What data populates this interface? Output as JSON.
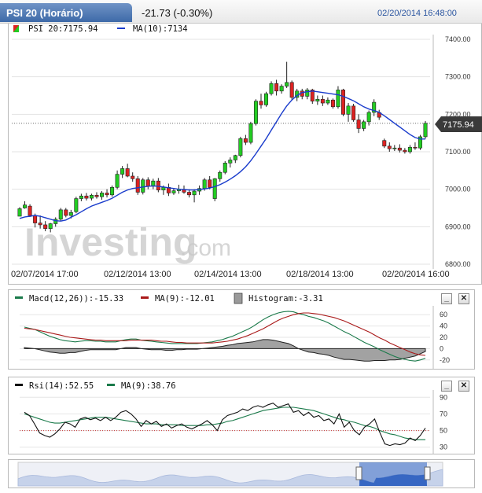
{
  "header": {
    "title": "PSI 20 (Horário)",
    "change": "-21.73 (-0.30%)",
    "datetime": "02/20/2014 16:48:00"
  },
  "main_legend": {
    "price": "PSI 20:7175.94",
    "ma": "MA(10):7134"
  },
  "last_price_label": "7175.94",
  "watermark": {
    "brand": "Investing",
    "suffix": ".com"
  },
  "colors": {
    "up": "#22cc22",
    "down": "#dd2222",
    "ma": "#1a3ccc",
    "macd": "#1a7a4a",
    "signal": "#aa1a1a",
    "hist": "#8a8a8a",
    "rsi": "#111111",
    "rsi_ma": "#1a7a4a"
  },
  "macd_legend": {
    "macd": "Macd(12,26)):-15.33",
    "ma": "MA(9):-12.01",
    "hist": "Histogram:-3.31"
  },
  "rsi_legend": {
    "rsi": "Rsi(14):52.55",
    "ma": "MA(9):38.76"
  },
  "chart_data": [
    {
      "type": "candlestick",
      "title": "PSI 20 (Horário)",
      "ylim": [
        6800,
        7400
      ],
      "y_ticks": [
        "7400.00",
        "7300.00",
        "7200.00",
        "7100.00",
        "7000.00",
        "6900.00",
        "6800.00"
      ],
      "x_tick_labels": [
        "02/07/2014 17:00",
        "02/12/2014 13:00",
        "02/14/2014 13:00",
        "02/18/2014 13:00",
        "02/20/2014 16:00"
      ],
      "x_tick_index": [
        0,
        20,
        40,
        60,
        80
      ],
      "candles": [
        [
          6928,
          6952,
          6928,
          6948
        ],
        [
          6950,
          6968,
          6948,
          6958
        ],
        [
          6955,
          6960,
          6926,
          6930
        ],
        [
          6930,
          6935,
          6898,
          6910
        ],
        [
          6910,
          6930,
          6895,
          6905
        ],
        [
          6905,
          6915,
          6888,
          6895
        ],
        [
          6895,
          6910,
          6885,
          6908
        ],
        [
          6908,
          6925,
          6900,
          6920
        ],
        [
          6920,
          6950,
          6915,
          6945
        ],
        [
          6945,
          6950,
          6925,
          6930
        ],
        [
          6930,
          6945,
          6922,
          6938
        ],
        [
          6940,
          6980,
          6936,
          6975
        ],
        [
          6975,
          6988,
          6968,
          6982
        ],
        [
          6982,
          6990,
          6970,
          6976
        ],
        [
          6976,
          6988,
          6970,
          6984
        ],
        [
          6984,
          6992,
          6975,
          6980
        ],
        [
          6980,
          6995,
          6972,
          6990
        ],
        [
          6990,
          7000,
          6978,
          6985
        ],
        [
          6985,
          7010,
          6980,
          7005
        ],
        [
          7005,
          7050,
          7000,
          7040
        ],
        [
          7040,
          7062,
          7030,
          7055
        ],
        [
          7055,
          7068,
          7032,
          7035
        ],
        [
          7035,
          7045,
          7020,
          7028
        ],
        [
          7028,
          7035,
          6985,
          6992
        ],
        [
          6992,
          7030,
          6986,
          7025
        ],
        [
          7025,
          7032,
          7000,
          7008
        ],
        [
          7008,
          7028,
          7000,
          7022
        ],
        [
          7022,
          7030,
          6992,
          6998
        ],
        [
          6998,
          7010,
          6985,
          7005
        ],
        [
          7005,
          7015,
          6982,
          6990
        ],
        [
          6990,
          7002,
          6985,
          6996
        ],
        [
          6996,
          7012,
          6988,
          7000
        ],
        [
          7000,
          7010,
          6988,
          6992
        ],
        [
          6992,
          7000,
          6978,
          6985
        ],
        [
          6985,
          7000,
          6965,
          6995
        ],
        [
          6995,
          7010,
          6985,
          7002
        ],
        [
          7002,
          7030,
          6996,
          7025
        ],
        [
          7025,
          7035,
          7000,
          7005
        ],
        [
          6975,
          7030,
          6968,
          7028
        ],
        [
          7028,
          7050,
          7020,
          7045
        ],
        [
          7045,
          7075,
          7040,
          7070
        ],
        [
          7070,
          7085,
          7058,
          7078
        ],
        [
          7078,
          7092,
          7070,
          7090
        ],
        [
          7090,
          7140,
          7085,
          7135
        ],
        [
          7135,
          7145,
          7118,
          7125
        ],
        [
          7125,
          7180,
          7120,
          7175
        ],
        [
          7175,
          7240,
          7170,
          7235
        ],
        [
          7235,
          7255,
          7215,
          7225
        ],
        [
          7225,
          7260,
          7220,
          7255
        ],
        [
          7255,
          7288,
          7250,
          7282
        ],
        [
          7282,
          7292,
          7250,
          7262
        ],
        [
          7262,
          7280,
          7255,
          7275
        ],
        [
          7275,
          7340,
          7270,
          7285
        ],
        [
          7285,
          7290,
          7238,
          7245
        ],
        [
          7245,
          7268,
          7235,
          7262
        ],
        [
          7262,
          7268,
          7240,
          7248
        ],
        [
          7248,
          7270,
          7240,
          7265
        ],
        [
          7265,
          7268,
          7228,
          7235
        ],
        [
          7235,
          7250,
          7225,
          7240
        ],
        [
          7240,
          7250,
          7222,
          7230
        ],
        [
          7230,
          7245,
          7225,
          7238
        ],
        [
          7238,
          7242,
          7215,
          7220
        ],
        [
          7220,
          7275,
          7215,
          7265
        ],
        [
          7265,
          7268,
          7195,
          7200
        ],
        [
          7200,
          7230,
          7180,
          7222
        ],
        [
          7222,
          7228,
          7180,
          7185
        ],
        [
          7185,
          7200,
          7150,
          7162
        ],
        [
          7162,
          7185,
          7155,
          7180
        ],
        [
          7180,
          7210,
          7170,
          7205
        ],
        [
          7205,
          7240,
          7195,
          7232
        ],
        [
          7205,
          7212,
          7185,
          7192
        ],
        [
          7130,
          7135,
          7110,
          7115
        ],
        [
          7115,
          7125,
          7100,
          7108
        ],
        [
          7108,
          7118,
          7102,
          7110
        ],
        [
          7110,
          7120,
          7098,
          7104
        ],
        [
          7104,
          7110,
          7095,
          7100
        ],
        [
          7100,
          7118,
          7095,
          7112
        ],
        [
          7112,
          7125,
          7105,
          7110
        ],
        [
          7110,
          7145,
          7105,
          7140
        ],
        [
          7140,
          7182,
          7135,
          7176
        ]
      ],
      "ma": [
        6922,
        6926,
        6928,
        6930,
        6928,
        6924,
        6920,
        6916,
        6915,
        6918,
        6925,
        6932,
        6940,
        6948,
        6955,
        6960,
        6965,
        6970,
        6976,
        6984,
        6992,
        6998,
        7002,
        7004,
        7006,
        7008,
        7009,
        7008,
        7006,
        7004,
        7002,
        7000,
        6999,
        6998,
        6998,
        6999,
        7001,
        7003,
        7007,
        7012,
        7019,
        7027,
        7036,
        7047,
        7060,
        7076,
        7095,
        7115,
        7135,
        7158,
        7180,
        7202,
        7222,
        7238,
        7250,
        7258,
        7260,
        7262,
        7260,
        7258,
        7256,
        7254,
        7252,
        7248,
        7242,
        7236,
        7228,
        7220,
        7214,
        7210,
        7205,
        7196,
        7186,
        7176,
        7166,
        7156,
        7146,
        7138,
        7134,
        7134
      ]
    },
    {
      "type": "line",
      "title": "MACD",
      "ylim": [
        -30,
        70
      ],
      "y_ticks": [
        "60",
        "40",
        "20",
        "0",
        "-20"
      ],
      "series": [
        {
          "name": "Macd(12,26)",
          "values": [
            38,
            36,
            34,
            30,
            26,
            22,
            19,
            16,
            14,
            13,
            12,
            13,
            14,
            14,
            13,
            13,
            12,
            12,
            12,
            14,
            16,
            17,
            17,
            15,
            14,
            13,
            12,
            11,
            10,
            9,
            9,
            9,
            9,
            9,
            9,
            10,
            11,
            12,
            14,
            16,
            19,
            22,
            26,
            30,
            34,
            39,
            45,
            51,
            56,
            60,
            63,
            65,
            66,
            65,
            62,
            60,
            57,
            55,
            52,
            49,
            45,
            40,
            35,
            30,
            26,
            21,
            16,
            11,
            7,
            3,
            -2,
            -6,
            -10,
            -14,
            -17,
            -19,
            -21,
            -22,
            -20,
            -17
          ]
        },
        {
          "name": "MA(9)",
          "values": [
            36,
            35,
            34,
            32,
            30,
            28,
            26,
            24,
            22,
            20,
            19,
            18,
            17,
            16,
            15,
            15,
            14,
            14,
            14,
            14,
            14,
            15,
            15,
            15,
            15,
            15,
            14,
            13,
            13,
            12,
            11,
            11,
            10,
            10,
            10,
            10,
            10,
            10,
            11,
            12,
            13,
            15,
            17,
            20,
            23,
            27,
            31,
            35,
            40,
            45,
            50,
            54,
            57,
            60,
            62,
            63,
            63,
            62,
            61,
            59,
            57,
            55,
            52,
            49,
            45,
            41,
            37,
            33,
            29,
            24,
            19,
            15,
            10,
            6,
            2,
            -2,
            -6,
            -9,
            -11,
            -12
          ]
        },
        {
          "name": "Histogram",
          "values": [
            2,
            1,
            0,
            -2,
            -4,
            -6,
            -7,
            -8,
            -8,
            -7,
            -7,
            -5,
            -3,
            -2,
            -2,
            -2,
            -2,
            -2,
            -2,
            0,
            2,
            2,
            2,
            0,
            -1,
            -2,
            -2,
            -2,
            -3,
            -3,
            -2,
            -2,
            -1,
            -1,
            -1,
            0,
            1,
            2,
            3,
            4,
            6,
            7,
            9,
            10,
            11,
            12,
            14,
            16,
            16,
            15,
            13,
            11,
            9,
            5,
            0,
            -3,
            -6,
            -7,
            -9,
            -10,
            -12,
            -15,
            -17,
            -19,
            -19,
            -20,
            -21,
            -22,
            -22,
            -21,
            -21,
            -21,
            -20,
            -20,
            -19,
            -17,
            -15,
            -13,
            -9,
            -5
          ]
        }
      ]
    },
    {
      "type": "line",
      "title": "RSI",
      "ylim": [
        25,
        95
      ],
      "y_ticks": [
        "90",
        "70",
        "50",
        "30"
      ],
      "reference_line": 50,
      "series": [
        {
          "name": "Rsi(14)",
          "values": [
            72,
            68,
            58,
            47,
            44,
            42,
            46,
            52,
            60,
            58,
            54,
            64,
            66,
            63,
            65,
            62,
            66,
            62,
            66,
            72,
            74,
            70,
            64,
            55,
            62,
            58,
            61,
            55,
            58,
            53,
            56,
            58,
            54,
            52,
            55,
            58,
            62,
            57,
            50,
            63,
            68,
            70,
            72,
            76,
            74,
            78,
            80,
            78,
            81,
            83,
            78,
            80,
            82,
            72,
            74,
            68,
            72,
            66,
            68,
            62,
            64,
            58,
            70,
            54,
            60,
            50,
            45,
            54,
            58,
            64,
            48,
            34,
            32,
            34,
            33,
            35,
            41,
            38,
            44,
            53
          ]
        },
        {
          "name": "MA(9)",
          "values": [
            70,
            68,
            66,
            64,
            62,
            60,
            59,
            59,
            60,
            61,
            62,
            63,
            64,
            65,
            66,
            66,
            66,
            65,
            64,
            63,
            62,
            61,
            60,
            59,
            58,
            58,
            58,
            57,
            57,
            57,
            57,
            56,
            56,
            56,
            56,
            56,
            57,
            57,
            58,
            59,
            61,
            62,
            64,
            66,
            68,
            70,
            72,
            74,
            75,
            76,
            77,
            78,
            78,
            78,
            77,
            76,
            75,
            74,
            72,
            70,
            68,
            66,
            64,
            63,
            61,
            60,
            58,
            56,
            55,
            53,
            50,
            48,
            46,
            45,
            43,
            41,
            40,
            39,
            39,
            39
          ]
        }
      ]
    }
  ]
}
